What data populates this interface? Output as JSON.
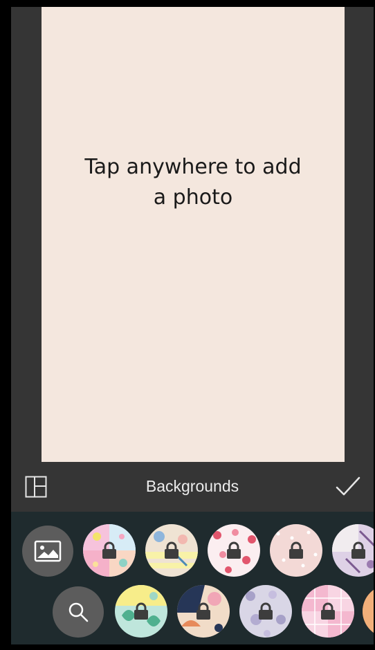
{
  "canvas": {
    "hint": "Tap anywhere to add a photo",
    "background_color": "#f4e7de"
  },
  "toolbar": {
    "title": "Backgrounds",
    "layout_icon": "layout-icon",
    "confirm_icon": "checkmark-icon"
  },
  "tray": {
    "photo_button_icon": "image-icon",
    "search_button_icon": "search-icon",
    "row1": [
      {
        "pattern": "pink-yellow-blue-patchwork",
        "locked": true
      },
      {
        "pattern": "beige-blue-doodle",
        "locked": true
      },
      {
        "pattern": "white-red-hearts",
        "locked": true
      },
      {
        "pattern": "blush-pink-dots",
        "locked": true
      },
      {
        "pattern": "purple-botanical",
        "locked": true
      }
    ],
    "row2": [
      {
        "pattern": "mint-yellow-leaves",
        "locked": true
      },
      {
        "pattern": "navy-pink-shapes",
        "locked": true
      },
      {
        "pattern": "lavender-floral",
        "locked": true
      },
      {
        "pattern": "pink-plaid-grid",
        "locked": true
      },
      {
        "pattern": "orange-warm",
        "locked": true
      }
    ],
    "lock_icon": "lock-icon"
  }
}
